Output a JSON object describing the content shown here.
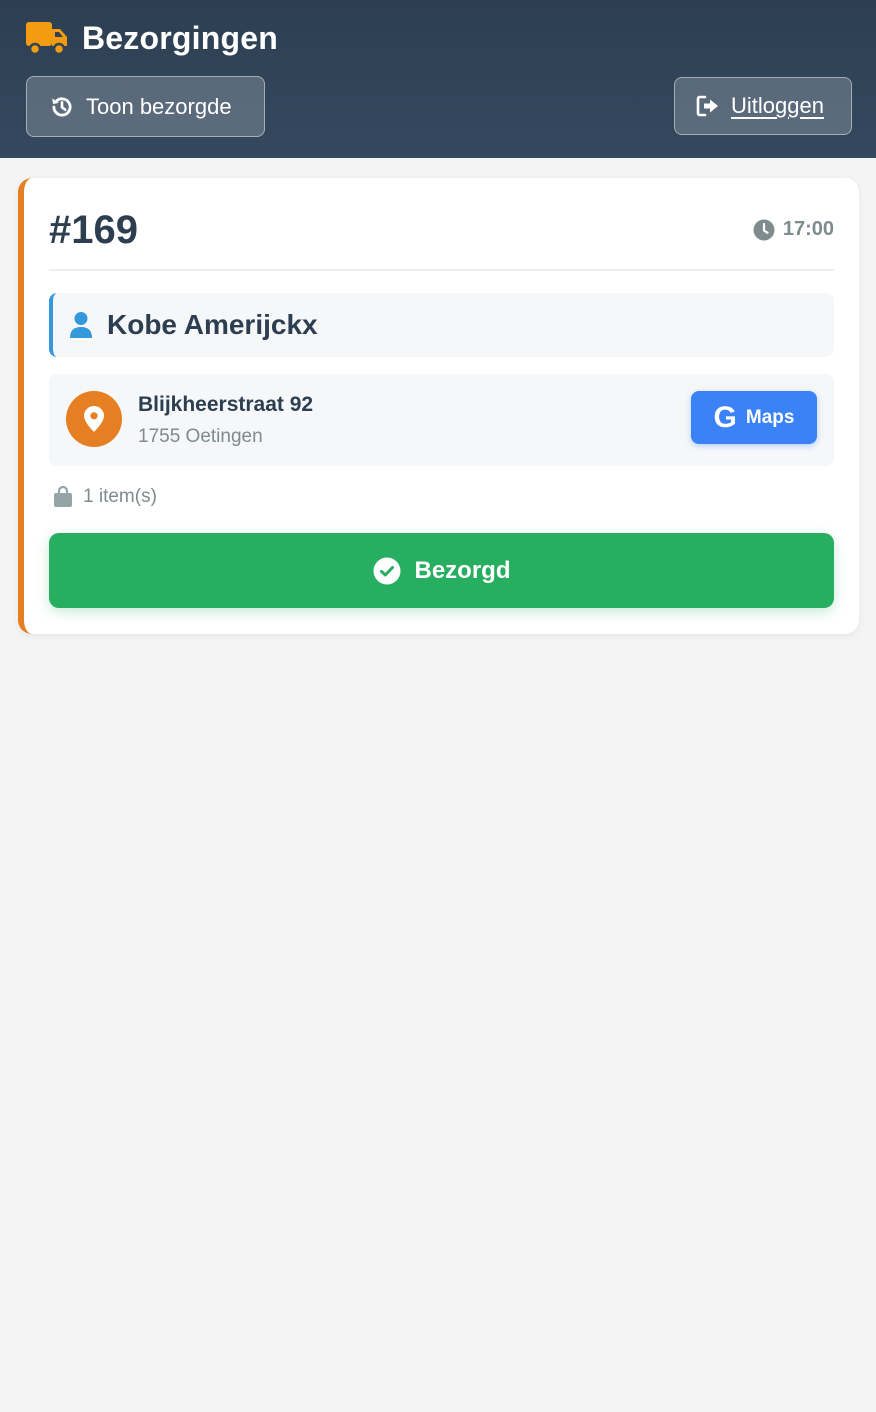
{
  "header": {
    "title": "Bezorgingen",
    "brand_icon": "truck-icon",
    "history_button": {
      "label": "Toon bezorgde",
      "icon": "history-icon"
    },
    "logout_button": {
      "label": "Uitloggen",
      "icon": "sign-out-icon"
    }
  },
  "order": {
    "number": "#169",
    "time": "17:00",
    "customer_name": "Kobe Amerijckx",
    "address": {
      "street": "Blijkheerstraat 92",
      "city": "1755 Oetingen"
    },
    "maps_button": {
      "label": "Maps",
      "glyph": "G"
    },
    "items_text": "1 item(s)",
    "delivered_button": {
      "label": "Bezorgd"
    }
  },
  "colors": {
    "header_bg": "#2d3e52",
    "accent_orange": "#e67e22",
    "truck_yellow": "#f39c12",
    "customer_blue": "#3498db",
    "maps_blue": "#3b82f6",
    "success_green": "#27ae60",
    "muted_text": "#7f8c8d",
    "dark_text": "#2c3e50"
  }
}
